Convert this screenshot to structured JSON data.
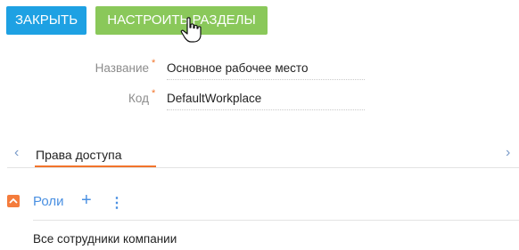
{
  "toolbar": {
    "close_label": "ЗАКРЫТЬ",
    "setup_label": "НАСТРОИТЬ РАЗДЕЛЫ",
    "close_color": "#1ea1e3",
    "setup_color": "#8ac85a"
  },
  "form": {
    "name_label": "Название",
    "name_value": "Основное рабочее место",
    "code_label": "Код",
    "code_value": "DefaultWorkplace",
    "required_marker": "*"
  },
  "tabs": {
    "active_label": "Права доступа",
    "left_arrow": "‹",
    "right_arrow": "›"
  },
  "roles": {
    "title": "Роли",
    "items": [
      "Все сотрудники компании"
    ]
  },
  "colors": {
    "accent_orange": "#f2742b",
    "link_blue": "#4a90e2"
  }
}
